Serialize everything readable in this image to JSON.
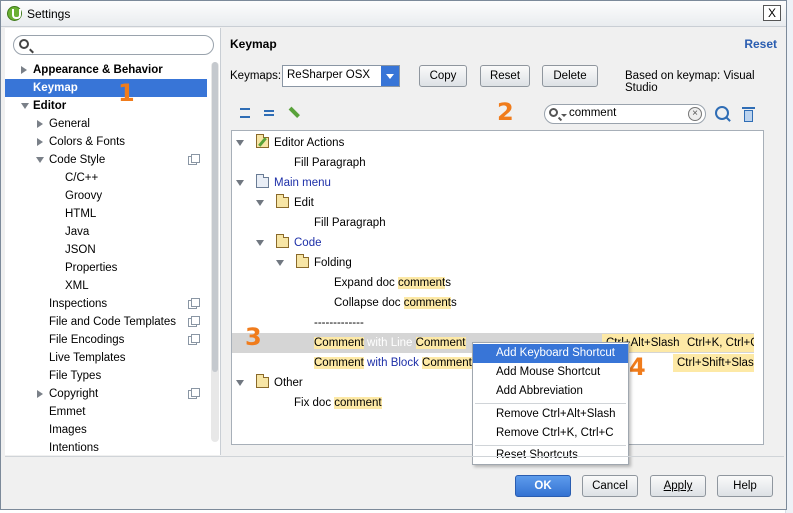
{
  "window": {
    "title": "Settings",
    "close_label": "X"
  },
  "search": {
    "placeholder": ""
  },
  "sidebar": {
    "items": [
      {
        "label": "Appearance & Behavior"
      },
      {
        "label": "Keymap"
      },
      {
        "label": "Editor"
      },
      {
        "label": "General"
      },
      {
        "label": "Colors & Fonts"
      },
      {
        "label": "Code Style"
      },
      {
        "label": "C/C++"
      },
      {
        "label": "Groovy"
      },
      {
        "label": "HTML"
      },
      {
        "label": "Java"
      },
      {
        "label": "JSON"
      },
      {
        "label": "Properties"
      },
      {
        "label": "XML"
      },
      {
        "label": "Inspections"
      },
      {
        "label": "File and Code Templates"
      },
      {
        "label": "File Encodings"
      },
      {
        "label": "Live Templates"
      },
      {
        "label": "File Types"
      },
      {
        "label": "Copyright"
      },
      {
        "label": "Emmet"
      },
      {
        "label": "Images"
      },
      {
        "label": "Intentions"
      }
    ]
  },
  "markers": [
    "1",
    "2",
    "3",
    "4"
  ],
  "keymap": {
    "heading": "Keymap",
    "reset_link": "Reset",
    "keymaps_label": "Keymaps:",
    "selected_keymap": "ReSharper OSX",
    "copy_button": "Copy",
    "reset_button": "Reset",
    "delete_button": "Delete",
    "based_on": "Based on keymap: Visual Studio",
    "filter_value": "comment"
  },
  "tree": {
    "editor_actions": "Editor Actions",
    "fill_paragraph_1": "Fill Paragraph",
    "main_menu": "Main menu",
    "edit": "Edit",
    "fill_paragraph_2": "Fill Paragraph",
    "code": "Code",
    "folding": "Folding",
    "expand_prefix": "Expand doc ",
    "expand_hl": "comment",
    "expand_suffix": "s",
    "collapse_prefix": "Collapse doc ",
    "collapse_hl": "comment",
    "collapse_suffix": "s",
    "separator": "-------------",
    "line_hl1": "Comment",
    "line_mid": " with Line ",
    "line_hl2": "Comment",
    "line_shortcut1": "Ctrl+Alt+Slash",
    "line_shortcut2": "Ctrl+K, Ctrl+C",
    "block_hl1": "Comment",
    "block_mid": " with Block ",
    "block_hl2": "Comment",
    "block_shortcut": "Ctrl+Shift+Slash",
    "other": "Other",
    "fix_prefix": "Fix doc ",
    "fix_hl": "comment"
  },
  "context_menu": {
    "items": [
      "Add Keyboard Shortcut",
      "Add Mouse Shortcut",
      "Add Abbreviation",
      "Remove Ctrl+Alt+Slash",
      "Remove Ctrl+K, Ctrl+C",
      "Reset Shortcuts"
    ]
  },
  "footer": {
    "ok": "OK",
    "cancel": "Cancel",
    "apply": "Apply",
    "help": "Help"
  },
  "colors": {
    "accent": "#3875d7",
    "marker": "#f07c1c",
    "highlight": "#fde9a6"
  }
}
